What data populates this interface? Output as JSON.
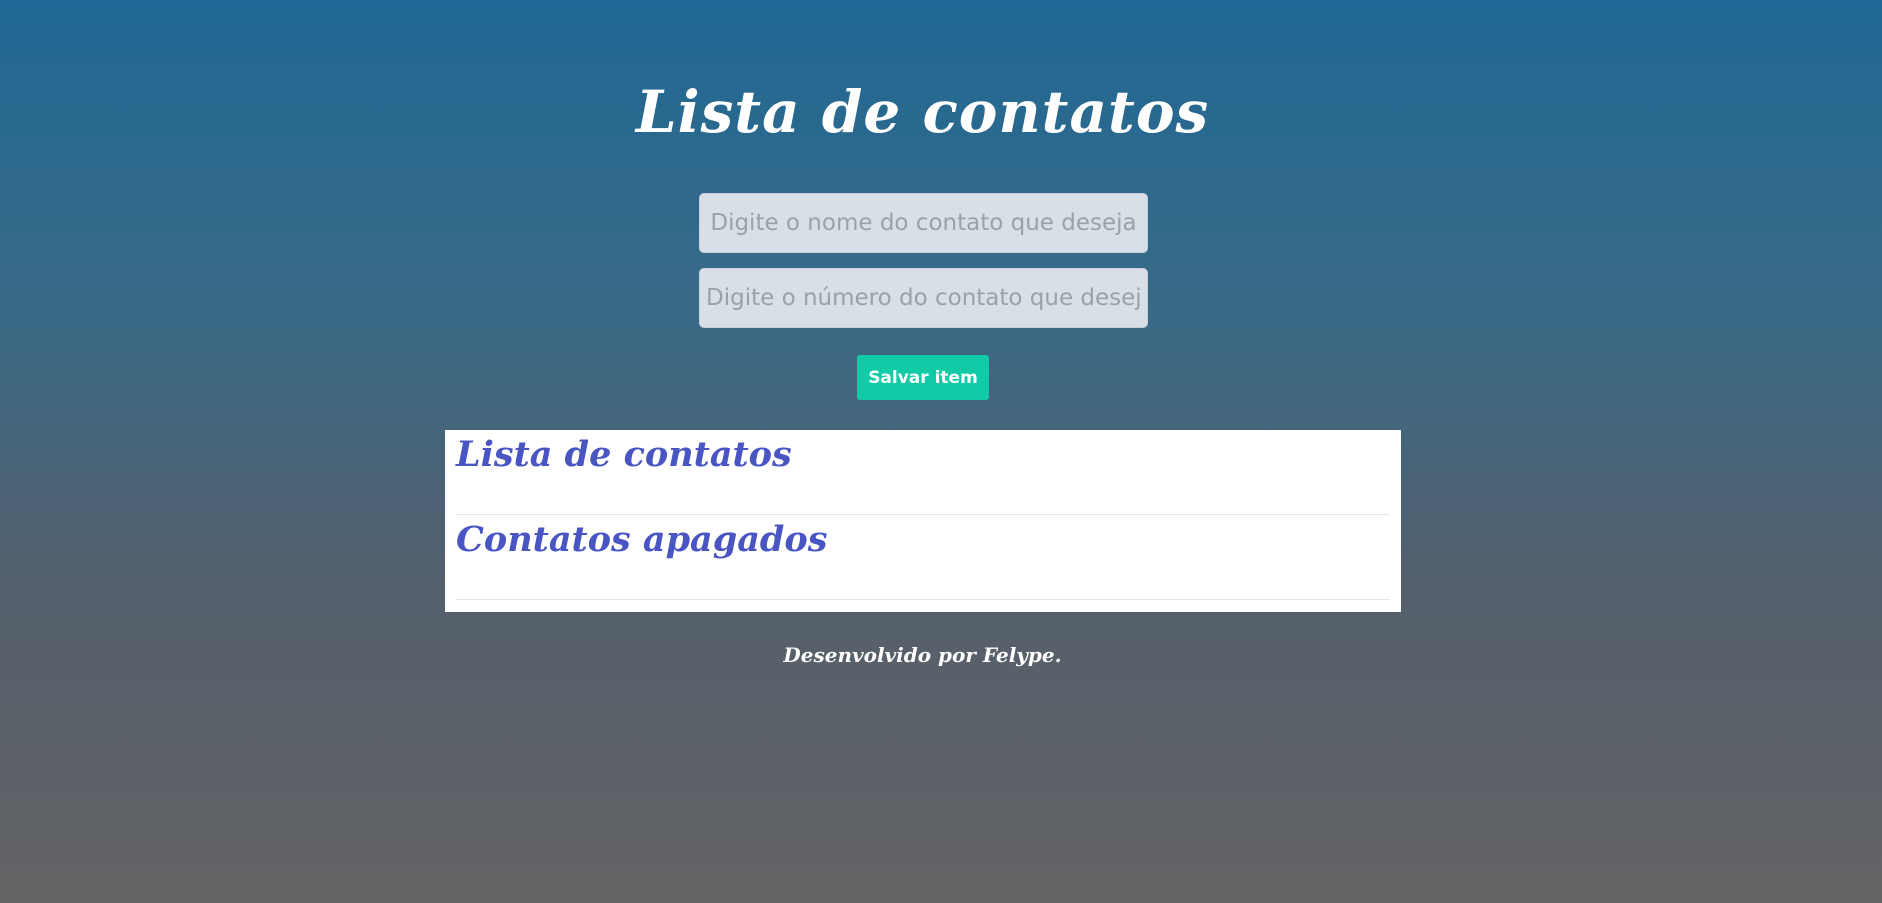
{
  "header": {
    "title": "Lista de contatos"
  },
  "form": {
    "name_placeholder": "Digite o nome do contato que deseja",
    "number_placeholder": "Digite o número do contato que deseja",
    "save_label": "Salvar item"
  },
  "lists": {
    "active_title": "Lista de contatos",
    "deleted_title": "Contatos apagados"
  },
  "footer": {
    "credit": "Desenvolvido por Felype."
  },
  "colors": {
    "accent_button": "#10cba6",
    "list_heading": "#4a55c4",
    "background_top": "#1f6895",
    "background_bottom": "#646465"
  }
}
